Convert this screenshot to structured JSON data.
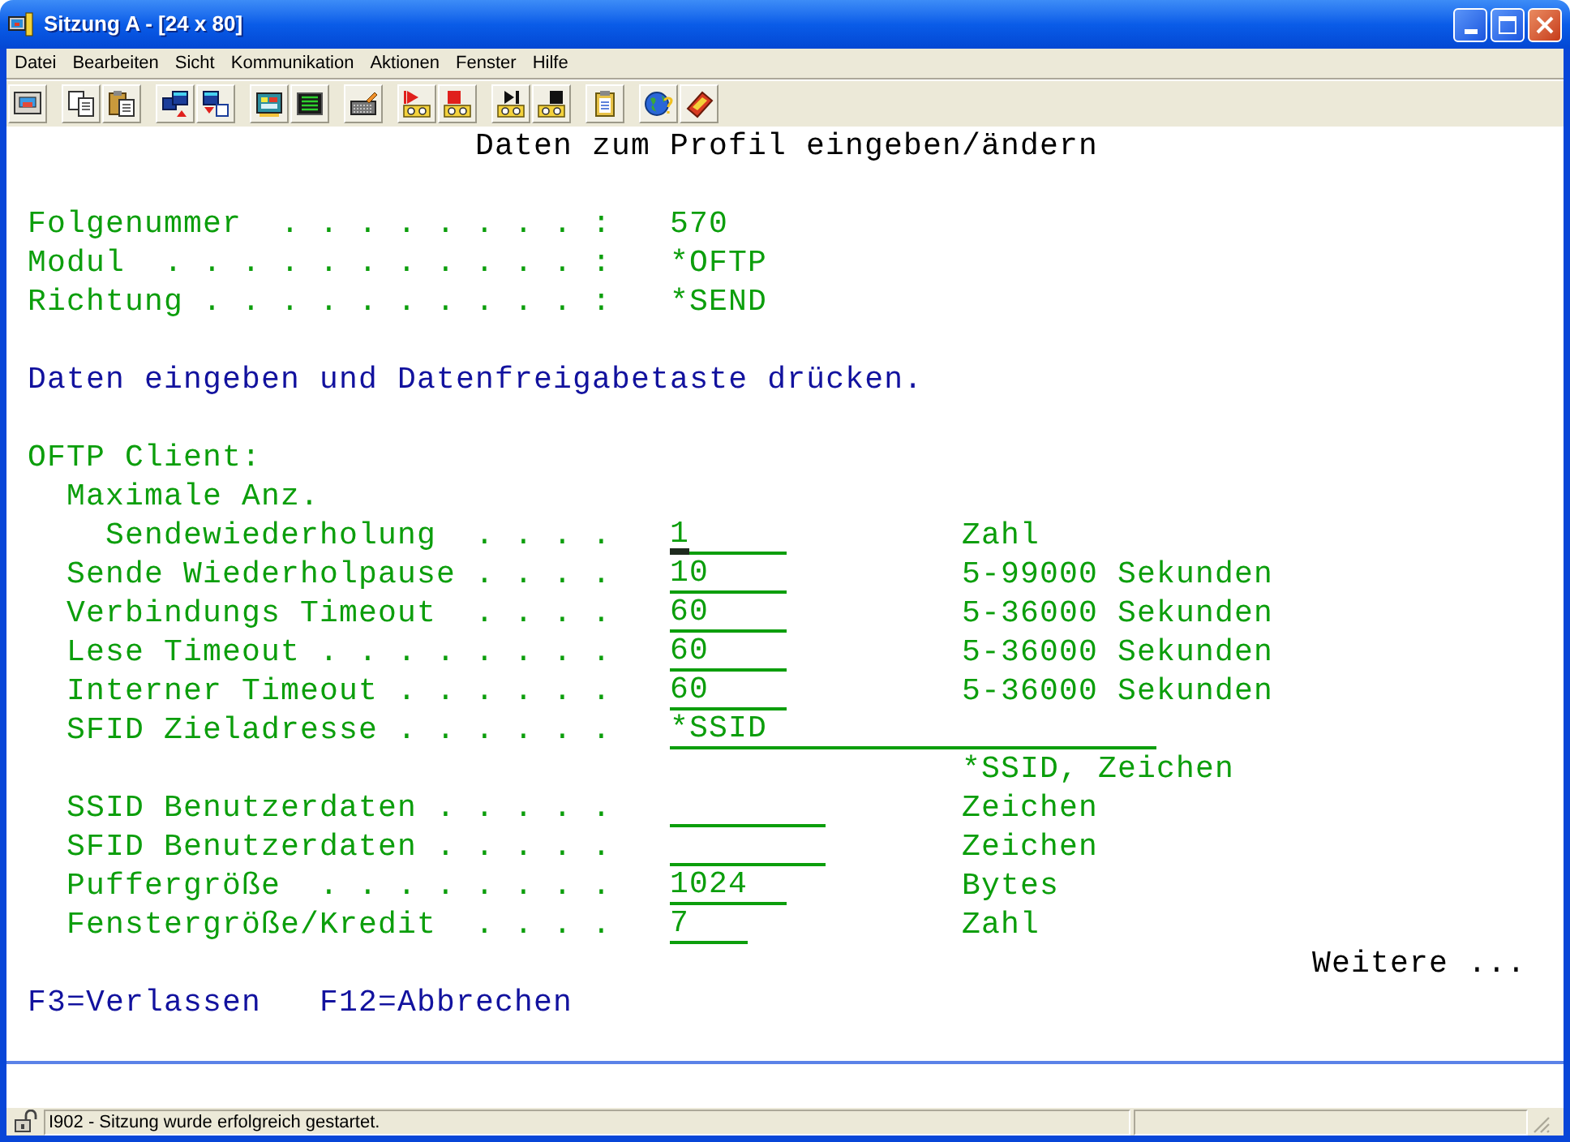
{
  "window": {
    "title": "Sitzung A - [24 x 80]"
  },
  "menu": [
    "Datei",
    "Bearbeiten",
    "Sicht",
    "Kommunikation",
    "Aktionen",
    "Fenster",
    "Hilfe"
  ],
  "screen": {
    "title": "Daten zum Profil eingeben/ändern",
    "info_fields": [
      {
        "label": "Folgenummer  . . . . . . . . :",
        "value": "570"
      },
      {
        "label": "Modul  . . . . . . . . . . . :",
        "value": "*OFTP"
      },
      {
        "label": "Richtung . . . . . . . . . . :",
        "value": "*SEND"
      }
    ],
    "instruction": "Daten eingeben und Datenfreigabetaste drücken.",
    "section": {
      "heading": "OFTP Client:",
      "fields": [
        {
          "group_label": "Maximale Anz.",
          "label": "Sendewiederholung  . . . .",
          "value": "1",
          "hint": "Zahl",
          "cursor": true
        },
        {
          "label": "Sende Wiederholpause . . . .",
          "value": "10",
          "hint": "5-99000 Sekunden",
          "cursor": false
        },
        {
          "label": "Verbindungs Timeout  . . . .",
          "value": "60",
          "hint": "5-36000 Sekunden",
          "cursor": false
        },
        {
          "label": "Lese Timeout . . . . . . . .",
          "value": "60",
          "hint": "5-36000 Sekunden",
          "cursor": false
        },
        {
          "label": "Interner Timeout . . . . . .",
          "value": "60",
          "hint": "5-36000 Sekunden",
          "cursor": false
        },
        {
          "label": "SFID Zieladresse . . . . . .",
          "value": "*SSID",
          "hint": "*SSID, Zeichen",
          "cursor": false
        },
        {
          "label": "SSID Benutzerdaten . . . . .",
          "hint": "Zeichen",
          "cursor": false
        },
        {
          "label": "SFID Benutzerdaten . . . . .",
          "hint": "Zeichen",
          "cursor": false
        },
        {
          "label": "Puffergröße  . . . . . . . .",
          "value": "1024",
          "hint": "Bytes",
          "cursor": false
        },
        {
          "label": "Fenstergröße/Kredit  . . . .",
          "value": "7",
          "hint": "Zahl",
          "cursor": false
        }
      ]
    },
    "more": "Weitere ...",
    "function_keys": [
      "F3=Verlassen",
      "F12=Abbrechen"
    ]
  },
  "status_bar": {
    "message": "I902 - Sitzung wurde erfolgreich gestartet."
  }
}
